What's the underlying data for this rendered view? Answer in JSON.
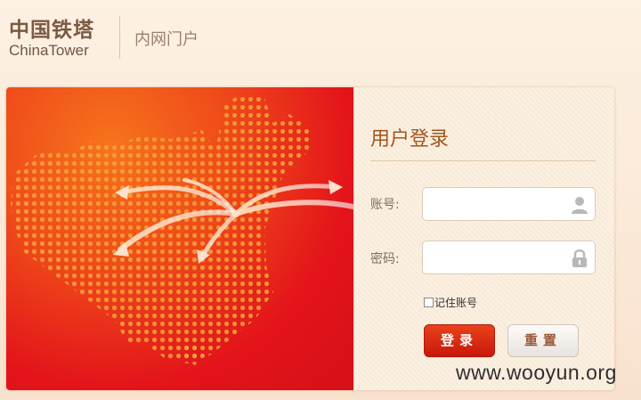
{
  "header": {
    "logo_cn": "中国铁塔",
    "logo_en": "ChinaTower",
    "portal_label": "内网门户"
  },
  "login": {
    "title": "用户登录",
    "account_label": "账号:",
    "password_label": "密码:",
    "account_value": "",
    "password_value": "",
    "remember_label": "记住账号",
    "remember_checked": false,
    "login_button": "登录",
    "reset_button": "重置"
  },
  "icons": {
    "account": "user-icon",
    "password": "lock-icon"
  },
  "colors": {
    "accent": "#a2571f",
    "login_button": "#d8230f",
    "banner_red": "#e3141a",
    "banner_orange": "#f6741c"
  },
  "watermark": "www.wooyun.org"
}
